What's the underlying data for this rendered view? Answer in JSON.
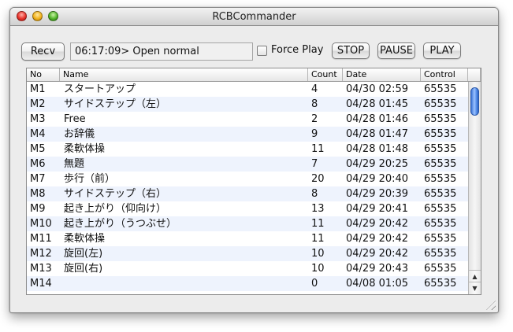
{
  "window": {
    "title": "RCBCommander"
  },
  "toolbar": {
    "recv_label": "Recv",
    "status_text": "06:17:09> Open normal",
    "force_play_label": "Force Play",
    "force_play_checked": false,
    "stop_label": "STOP",
    "pause_label": "PAUSE",
    "play_label": "PLAY"
  },
  "table": {
    "columns": [
      "No",
      "Name",
      "Count",
      "Date",
      "Control"
    ],
    "rows": [
      {
        "no": "M1",
        "name": "スタートアップ",
        "count": "4",
        "date": "04/30 02:59",
        "control": "65535"
      },
      {
        "no": "M2",
        "name": "サイドステップ（左）",
        "count": "8",
        "date": "04/28 01:45",
        "control": "65535"
      },
      {
        "no": "M3",
        "name": "Free",
        "count": "2",
        "date": "04/28 01:46",
        "control": "65535"
      },
      {
        "no": "M4",
        "name": "お辞儀",
        "count": "9",
        "date": "04/28 01:47",
        "control": "65535"
      },
      {
        "no": "M5",
        "name": "柔軟体操",
        "count": "11",
        "date": "04/28 01:48",
        "control": "65535"
      },
      {
        "no": "M6",
        "name": "無題",
        "count": "7",
        "date": "04/29 20:25",
        "control": "65535"
      },
      {
        "no": "M7",
        "name": "歩行（前）",
        "count": "20",
        "date": "04/29 20:40",
        "control": "65535"
      },
      {
        "no": "M8",
        "name": "サイドステップ（右）",
        "count": "8",
        "date": "04/29 20:39",
        "control": "65535"
      },
      {
        "no": "M9",
        "name": "起き上がり（仰向け）",
        "count": "13",
        "date": "04/29 20:41",
        "control": "65535"
      },
      {
        "no": "M10",
        "name": "起き上がり（うつぶせ）",
        "count": "11",
        "date": "04/29 20:42",
        "control": "65535"
      },
      {
        "no": "M11",
        "name": "柔軟体操",
        "count": "11",
        "date": "04/29 20:42",
        "control": "65535"
      },
      {
        "no": "M12",
        "name": "旋回(左)",
        "count": "10",
        "date": "04/29 20:42",
        "control": "65535"
      },
      {
        "no": "M13",
        "name": "旋回(右)",
        "count": "10",
        "date": "04/29 20:43",
        "control": "65535"
      },
      {
        "no": "M14",
        "name": "",
        "count": "0",
        "date": "04/08 01:05",
        "control": "65535"
      }
    ]
  },
  "icons": {
    "close": "close-traffic-light",
    "minimize": "minimize-traffic-light",
    "zoom": "zoom-traffic-light",
    "scroll_up": "scroll-up-arrow",
    "scroll_down": "scroll-down-arrow",
    "resize": "resize-grip"
  },
  "colors": {
    "row_alt": "#eef3fd",
    "scroll_thumb": "#5b93ec",
    "close": "#e8342c",
    "minimize": "#f1b21c",
    "zoom": "#53b52c"
  }
}
